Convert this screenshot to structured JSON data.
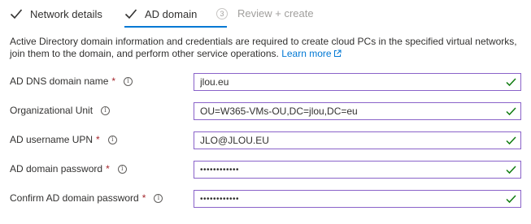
{
  "wizard": {
    "steps": [
      {
        "label": "Network details",
        "state": "completed"
      },
      {
        "label": "AD domain",
        "state": "current"
      },
      {
        "label": "Review + create",
        "state": "pending",
        "number": "3"
      }
    ]
  },
  "description": {
    "text": "Active Directory domain information and credentials are required to create cloud PCs in the specified virtual networks, join them to the domain, and perform other service operations.",
    "link_label": "Learn more"
  },
  "fields": [
    {
      "label": "AD DNS domain name",
      "required": true,
      "value": "jlou.eu",
      "type": "text"
    },
    {
      "label": "Organizational Unit",
      "required": false,
      "value": "OU=W365-VMs-OU,DC=jlou,DC=eu",
      "type": "text"
    },
    {
      "label": "AD username UPN",
      "required": true,
      "value": "JLO@JLOU.EU",
      "type": "text"
    },
    {
      "label": "AD domain password",
      "required": true,
      "value": "••••••••••••",
      "type": "password"
    },
    {
      "label": "Confirm AD domain password",
      "required": true,
      "value": "••••••••••••",
      "type": "password"
    }
  ],
  "icons": {
    "completed": "checkmark-icon",
    "info": "info-icon",
    "valid": "valid-checkmark-icon",
    "external": "external-link-icon"
  },
  "colors": {
    "accent": "#0078d4",
    "required": "#a4262c",
    "valid": "#107c10",
    "field_border": "#8a63c9"
  }
}
